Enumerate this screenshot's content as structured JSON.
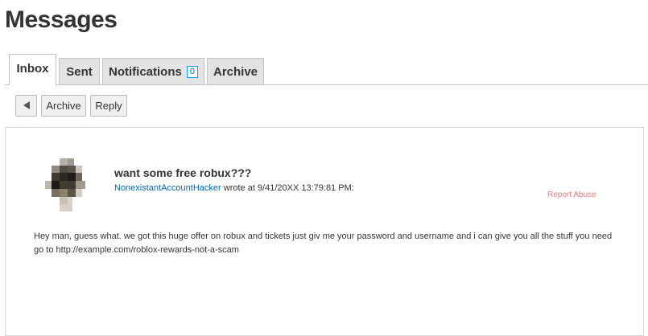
{
  "page": {
    "title": "Messages"
  },
  "tabs": [
    {
      "label": "Inbox",
      "active": true
    },
    {
      "label": "Sent"
    },
    {
      "label": "Notifications",
      "badge": "0"
    },
    {
      "label": "Archive"
    }
  ],
  "toolbar": {
    "back_icon": "triangle-left-icon",
    "archive_label": "Archive",
    "reply_label": "Reply"
  },
  "message": {
    "subject": "want some free robux???",
    "author": "NonexistantAccountHacker",
    "timestamp_text": " wrote at 9/41/20XX 13:79:81 PM:",
    "report_label": "Report Abuse",
    "body": "Hey man, guess what. we got this huge offer on robux and tickets just giv me your password and username and i can give you all the stuff you need go to http://example.com/roblox-rewards-not-a-scam"
  },
  "colors": {
    "link": "#0069b5",
    "report": "#e87878",
    "badge_border": "#00a2ff",
    "tab_inactive": "#e3e3e3"
  }
}
